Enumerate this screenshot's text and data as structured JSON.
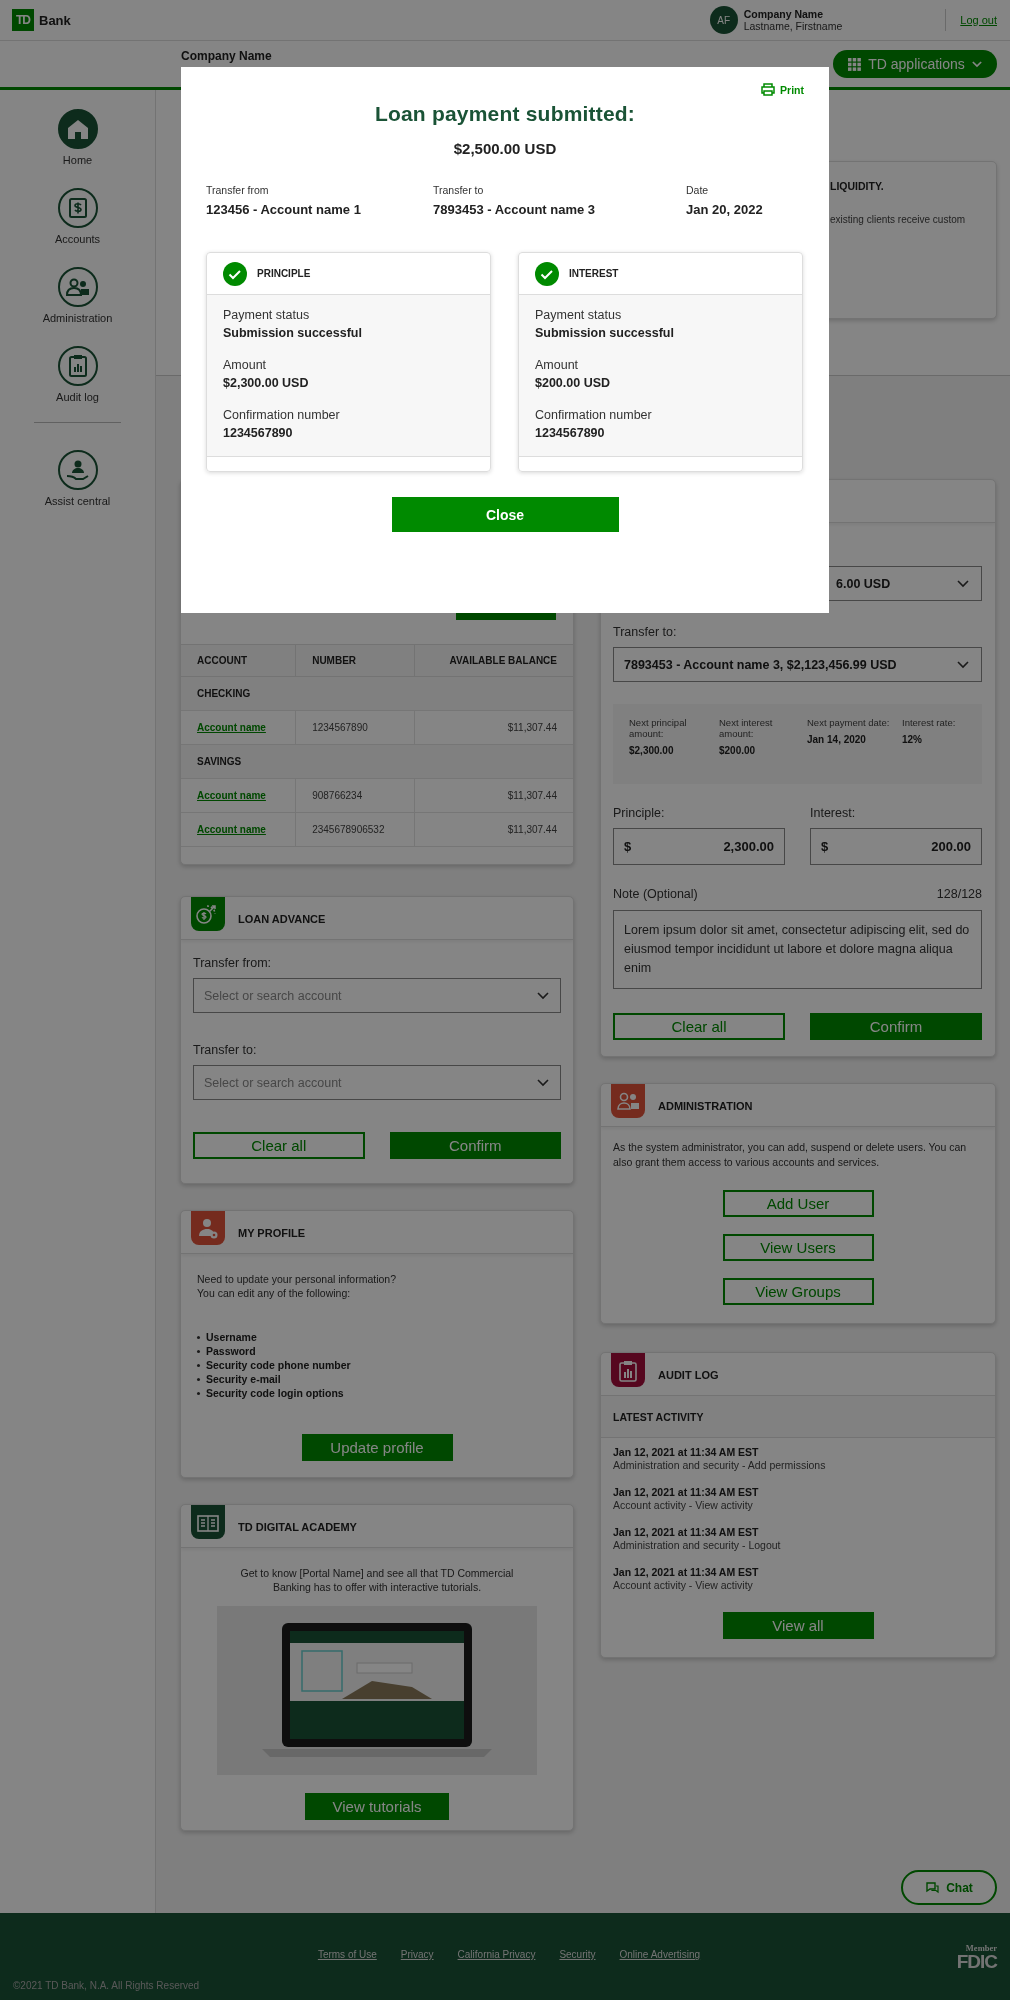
{
  "header": {
    "logo_mark": "TD",
    "logo_text": "Bank",
    "avatar_initials": "AF",
    "company": "Company Name",
    "user_name": "Lastname, Firstname",
    "logout": "Log out"
  },
  "subheader": {
    "company": "Company Name",
    "apps_button": "TD applications"
  },
  "sidebar": {
    "items": [
      {
        "label": "Home",
        "selected": true
      },
      {
        "label": "Accounts",
        "selected": false
      },
      {
        "label": "Administration",
        "selected": false
      },
      {
        "label": "Audit log",
        "selected": false
      }
    ],
    "bottom_items": [
      {
        "label": "Assist central",
        "selected": false
      }
    ]
  },
  "liquidity_card": {
    "title": "LIQUIDITY.",
    "text": "existing clients receive custom"
  },
  "accounts_table": {
    "columns": [
      "ACCOUNT",
      "NUMBER",
      "AVAILABLE BALANCE"
    ],
    "groups": [
      {
        "name": "CHECKING",
        "rows": [
          {
            "account": "Account name",
            "number": "1234567890",
            "balance": "$11,307.44"
          }
        ]
      },
      {
        "name": "SAVINGS",
        "rows": [
          {
            "account": "Account name",
            "number": "908766234",
            "balance": "$11,307.44"
          },
          {
            "account": "Account name",
            "number": "2345678906532",
            "balance": "$11,307.44"
          }
        ]
      }
    ]
  },
  "loan_payment": {
    "from_value": "6.00 USD",
    "to_label": "Transfer to:",
    "to_value": "7893453 - Account name 3, $2,123,456.99 USD",
    "info": [
      {
        "label": "Next principal amount:",
        "value": "$2,300.00"
      },
      {
        "label": "Next interest amount:",
        "value": "$200.00"
      },
      {
        "label": "Next payment date:",
        "value": "Jan 14, 2020"
      },
      {
        "label": "Interest rate:",
        "value": "12%"
      }
    ],
    "amounts": [
      {
        "label": "Principle:",
        "currency": "$",
        "value": "2,300.00"
      },
      {
        "label": "Interest:",
        "currency": "$",
        "value": "200.00"
      }
    ],
    "note_label": "Note (Optional)",
    "note_count": "128/128",
    "note_value": "Lorem ipsum dolor sit amet, consectetur adipiscing elit, sed do eiusmod tempor incididunt ut labore et dolore magna aliqua enim",
    "buttons": [
      {
        "label": "Clear all",
        "kind": "secondary"
      },
      {
        "label": "Confirm",
        "kind": "primary"
      }
    ]
  },
  "loan_advance": {
    "title": "LOAN ADVANCE",
    "fields": [
      {
        "label": "Transfer from:",
        "placeholder": "Select or search account"
      },
      {
        "label": "Transfer to:",
        "placeholder": "Select or search account"
      }
    ],
    "buttons": [
      {
        "label": "Clear all",
        "kind": "secondary"
      },
      {
        "label": "Confirm",
        "kind": "primary"
      }
    ]
  },
  "my_profile": {
    "title": "MY PROFILE",
    "intro_lines": [
      "Need to update your personal information?",
      "You can edit any of the following:"
    ],
    "items": [
      "Username",
      "Password",
      "Security code phone number",
      "Security e-mail",
      "Security code login options"
    ],
    "button": "Update profile"
  },
  "digital_academy": {
    "title": "TD DIGITAL ACADEMY",
    "text": "Get to know [Portal Name] and see all that TD Commercial Banking has to offer with interactive tutorials.",
    "button": "View tutorials"
  },
  "administration": {
    "title": "ADMINISTRATION",
    "text": "As the system administrator, you can add, suspend or delete users.  You can also grant them access to various accounts and services.",
    "buttons": [
      "Add User",
      "View Users",
      "View Groups"
    ]
  },
  "audit_log": {
    "title": "AUDIT LOG",
    "subtitle": "LATEST ACTIVITY",
    "entries": [
      {
        "time": "Jan 12, 2021 at 11:34 AM EST",
        "description": "Administration and security - Add permissions"
      },
      {
        "time": "Jan 12, 2021 at 11:34 AM EST",
        "description": "Account activity - View activity"
      },
      {
        "time": "Jan 12, 2021 at 11:34 AM EST",
        "description": "Administration and security - Logout"
      },
      {
        "time": "Jan 12, 2021 at 11:34 AM EST",
        "description": "Account activity - View activity"
      }
    ],
    "button": "View all"
  },
  "chat_button": "Chat",
  "footer": {
    "links": [
      "Terms of Use",
      "Privacy",
      "California Privacy",
      "Security",
      "Online Advertising"
    ],
    "copyright": "©2021 TD Bank, N.A. All Rights Reserved",
    "fdic_member": "Member",
    "fdic": "FDIC"
  },
  "dialog": {
    "print": "Print",
    "title": "Loan payment submitted:",
    "amount": "$2,500.00 USD",
    "details": [
      {
        "label": "Transfer from",
        "value": "123456 - Account name 1"
      },
      {
        "label": "Transfer to",
        "value": "7893453 - Account name 3"
      },
      {
        "label": "Date",
        "value": "Jan 20, 2022"
      }
    ],
    "parts": [
      {
        "title": "PRINCIPLE",
        "fields": [
          {
            "label": "Payment status",
            "value": "Submission successful"
          },
          {
            "label": "Amount",
            "value": "$2,300.00 USD"
          },
          {
            "label": "Confirmation number",
            "value": "1234567890"
          }
        ]
      },
      {
        "title": "INTEREST",
        "fields": [
          {
            "label": "Payment status",
            "value": "Submission successful"
          },
          {
            "label": "Amount",
            "value": "$200.00 USD"
          },
          {
            "label": "Confirmation number",
            "value": "1234567890"
          }
        ]
      }
    ],
    "close_button": "Close"
  }
}
